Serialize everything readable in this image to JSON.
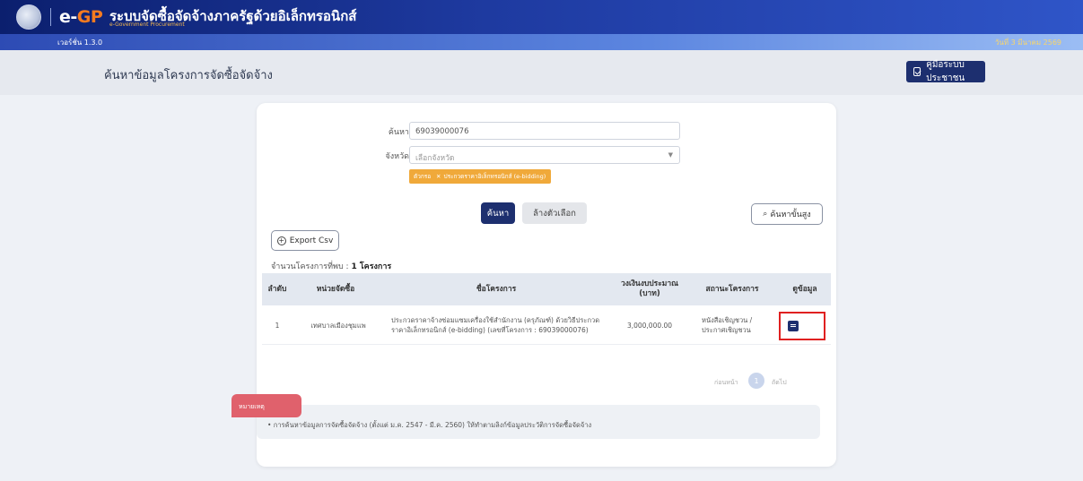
{
  "header": {
    "logo_e": "e-",
    "logo_gp": "GP",
    "site_title": "ระบบจัดซื้อจัดจ้างภาครัฐด้วยอิเล็กทรอนิกส์",
    "site_subtitle": "e-Government Procurement"
  },
  "strip": {
    "version": "เวอร์ชั่น 1.3.0",
    "today": "วันที่ 3 มีนาคม 2569"
  },
  "pagebar": {
    "title": "ค้นหาข้อมูลโครงการจัดซื้อจัดจ้าง",
    "manual_label": "คู่มือระบบประชาชน",
    "manual_icon": "checkbox-icon"
  },
  "search": {
    "keyword_label": "ค้นหา",
    "keyword_value": "69039000076",
    "province_label": "จังหวัด",
    "province_placeholder": "เลือกจังหวัด",
    "filter_tag_1": "ตัวกรอง",
    "filter_tag_2": "ประกวดราคาอิเล็กทรอนิกส์ (e-bidding)",
    "search_btn": "ค้นหา",
    "clear_btn": "ล้างตัวเลือก",
    "advanced_btn": "ค้นหาขั้นสูง",
    "export_btn": "Export Csv"
  },
  "results": {
    "count_label": "จำนวนโครงการที่พบ :",
    "count_value": "1 โครงการ",
    "columns": [
      "ลำดับ",
      "หน่วยจัดซื้อ",
      "ชื่อโครงการ",
      "วงเงินงบประมาณ (บาท)",
      "สถานะโครงการ",
      "ดูข้อมูล"
    ],
    "rows": [
      {
        "no": "1",
        "agency": "เทศบาลเมืองชุมแพ",
        "project": "ประกวดราคาจ้างซ่อมแซมเครื่องใช้สำนักงาน (ครุภัณฑ์) ด้วยวิธีประกวดราคาอิเล็กทรอนิกส์ (e-bidding) (เลขที่โครงการ : 69039000076)",
        "budget": "3,000,000.00",
        "status": "หนังสือเชิญชวน / ประกาศเชิญชวน",
        "view_icon": "document-icon"
      }
    ],
    "pager_prev": "ก่อนหน้า",
    "pager_page": "1",
    "pager_next": "ถัดไป"
  },
  "note": {
    "tab_label": "หมายเหตุ",
    "text": "• การค้นหาข้อมูลการจัดซื้อจัดจ้าง (ตั้งแต่ ม.ค. 2547 - มี.ค. 2560) ให้ทำตามลิงก์ข้อมูลประวัติการจัดซื้อจัดจ้าง"
  },
  "colors": {
    "primary": "#1d2f6f",
    "accent": "#f0a93a",
    "note_tab": "#e0616c",
    "highlight": "#e02020"
  }
}
